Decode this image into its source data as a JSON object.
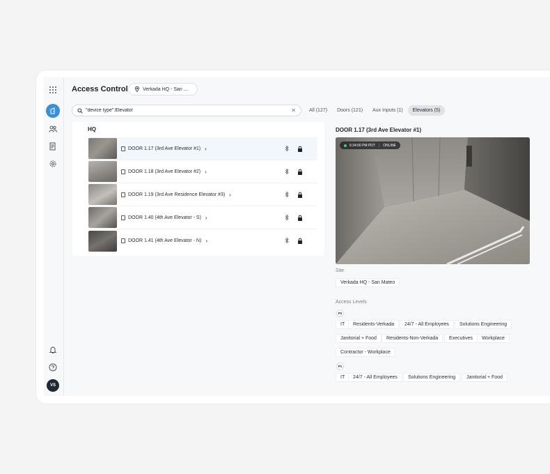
{
  "app": {
    "title": "Access Control",
    "site_selector": "Verkada HQ - San ..."
  },
  "search": {
    "value": "\"device type\":Elevator",
    "clear_icon": "close-icon"
  },
  "filter_tabs": [
    {
      "label": "All (127)",
      "active": false
    },
    {
      "label": "Doors (121)",
      "active": false
    },
    {
      "label": "Aux Inputs (1)",
      "active": false
    },
    {
      "label": "Elevators (5)",
      "active": true
    }
  ],
  "list": {
    "group": "HQ",
    "doors": [
      {
        "name": "DOOR 1.17 (3rd Ave Elevator #1)",
        "selected": true
      },
      {
        "name": "DOOR 1.18 (3rd Ave Elevator #2)",
        "selected": false
      },
      {
        "name": "DOOR 1.19 (3rd Ave Residence Elevator #3)",
        "selected": false
      },
      {
        "name": "DOOR 1.40 (4th Ave Elevator - S)",
        "selected": false
      },
      {
        "name": "DOOR 1.41 (4th Ave Elevator - N)",
        "selected": false
      }
    ]
  },
  "detail": {
    "title": "DOOR 1.17 (3rd Ave Elevator #1)",
    "camera": {
      "time": "6:34:00 PM PDT",
      "status": "ONLINE",
      "status_color": "#38d07a"
    },
    "site_label": "Site",
    "site_value": "Verkada HQ - San Mateo",
    "access_levels_label": "Access Levels",
    "floors": [
      {
        "badge": "P2",
        "levels": [
          "IT",
          "Residents-Verkada",
          "24/7 - All Employees",
          "Solutions Engineering",
          "Janitorial + Food",
          "Residents-Non-Verkada",
          "Executives",
          "Workplace",
          "Contractor - Workplace"
        ]
      },
      {
        "badge": "P1",
        "levels": [
          "IT",
          "24/7 - All Employees",
          "Solutions Engineering",
          "Janitorial + Food"
        ]
      }
    ]
  },
  "user": {
    "initials": "VS"
  },
  "colors": {
    "accent": "#3b8fd6",
    "background": "#f4f4f4"
  }
}
